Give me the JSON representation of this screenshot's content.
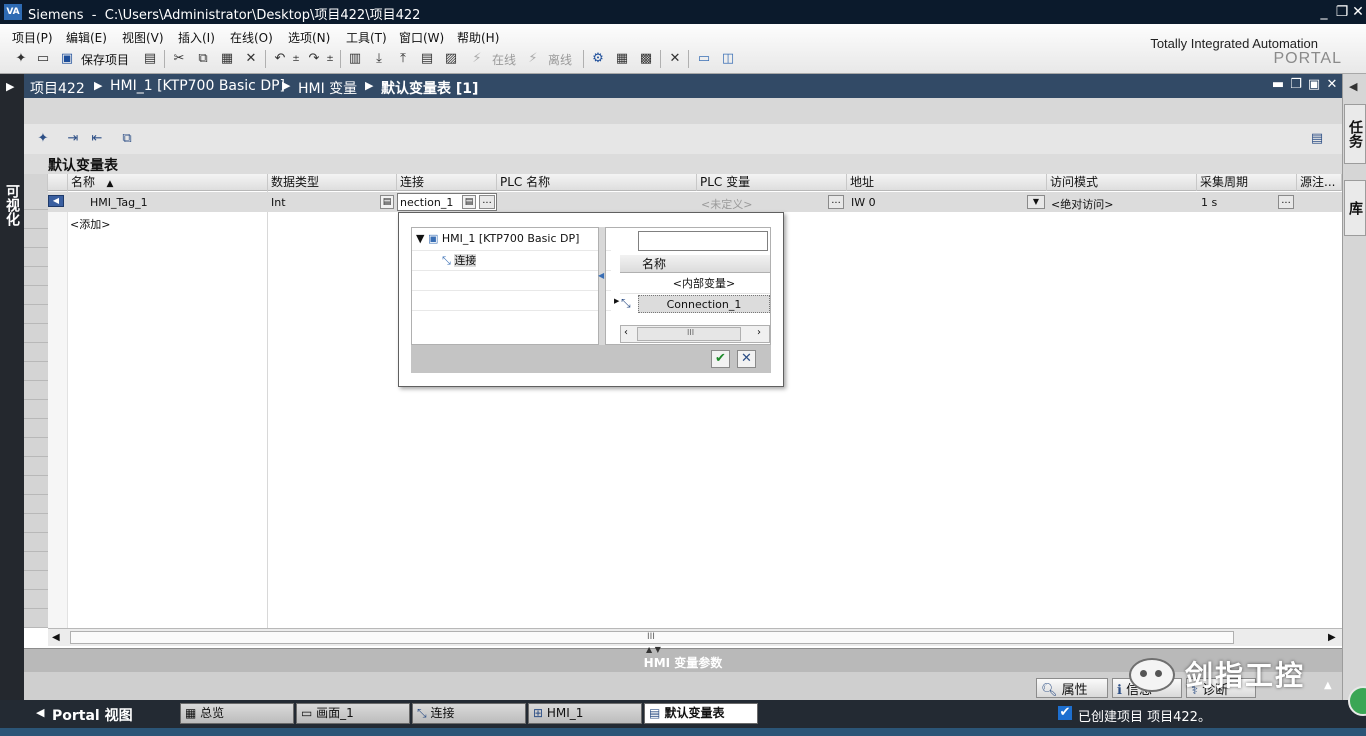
{
  "window": {
    "app_name": "Siemens",
    "path": "C:\\Users\\Administrator\\Desktop\\项目422\\项目422",
    "logo_text": "VA"
  },
  "menu": [
    "项目(P)",
    "编辑(E)",
    "视图(V)",
    "插入(I)",
    "在线(O)",
    "选项(N)",
    "工具(T)",
    "窗口(W)",
    "帮助(H)"
  ],
  "toolbar": {
    "save_label": "保存项目",
    "online_label": "在线",
    "offline_label": "离线"
  },
  "brand": {
    "line1": "Totally Integrated Automation",
    "line2": "PORTAL"
  },
  "breadcrumb": [
    "项目422",
    "HMI_1 [KTP700 Basic DP]",
    "HMI 变量",
    "默认变量表 [1]"
  ],
  "left_strip_label": "可视化",
  "right_tabs": [
    "任务",
    "库"
  ],
  "table": {
    "title": "默认变量表",
    "columns": [
      "名称",
      "数据类型",
      "连接",
      "PLC 名称",
      "PLC 变量",
      "地址",
      "访问模式",
      "采集周期",
      "源注..."
    ],
    "sort_indicator": "▲",
    "row": {
      "name": "HMI_Tag_1",
      "data_type": "Int",
      "connection": "nection_1",
      "plc_name": "",
      "plc_tag": "<未定义>",
      "address": "IW 0",
      "access_mode": "<绝对访问>",
      "acquisition_cycle": "1 s"
    },
    "add_row_label": "<添加>",
    "ellipsis": "..."
  },
  "popup": {
    "tree_root": "HMI_1 [KTP700 Basic DP]",
    "tree_child": "连接",
    "search_value": "",
    "list_header": "名称",
    "list_items": [
      "<内部变量>",
      "Connection_1"
    ],
    "scroll_thumb": "III"
  },
  "bottom_panel": {
    "title": "HMI 变量参数",
    "properties_label": "属性",
    "info_label": "信息",
    "diagnostics_label": "诊断"
  },
  "taskbar": {
    "portal_label": "Portal 视图",
    "tasks": [
      "总览",
      "画面_1",
      "连接",
      "HMI_1",
      "默认变量表"
    ],
    "status": "已创建项目 项目422。"
  },
  "watermark": "剑指工控",
  "colors": {
    "title_bar": "#0b1a2c",
    "breadcrumb_bar": "#324a66",
    "taskbar": "#232a33",
    "selection": "#dcdcdc"
  }
}
